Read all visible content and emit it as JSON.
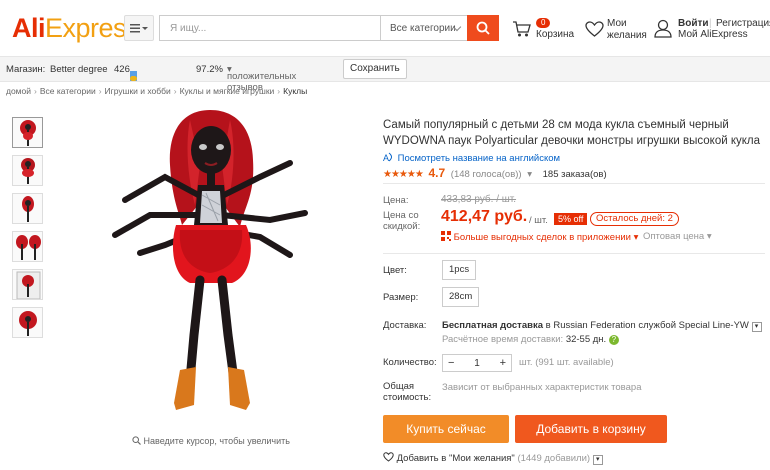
{
  "header": {
    "logo_ali": "Ali",
    "logo_express": "Express",
    "search_placeholder": "Я ищу...",
    "search_category": "Все категории",
    "cart_count": "0",
    "cart_label": "Корзина",
    "wish_line1": "Мои",
    "wish_line2": "желания",
    "login": "Войти",
    "separator": "|",
    "register": "Регистрация",
    "my_ali": "Мой AliExpress"
  },
  "store": {
    "label": "Магазин:",
    "name": "Better degree",
    "score": "426",
    "positive_pct": "97.2%",
    "positive_label": "положительных отзывов",
    "follow_label": "Сохранить"
  },
  "breadcrumb": [
    "домой",
    "Все категории",
    "Игрушки и хобби",
    "Куклы и мягкие игрушки",
    "Куклы"
  ],
  "gallery": {
    "zoom_hint": "Наведите курсор, чтобы увеличить",
    "thumb_count": 6
  },
  "product": {
    "title": "Самый популярный с детьми 28 см мода кукла съемный черный WYDOWNA паук Polyarticular девочки монстры игрушки высокой кукла",
    "translate_link": "Посмотреть название на английском",
    "stars": "★★★★★",
    "rating": "4.7",
    "votes": "(148 голоса(ов))",
    "orders": "185 заказа(ов)",
    "price_label": "Цена:",
    "old_price": "433,83 руб. / шт.",
    "discount_price_label_1": "Цена со",
    "discount_price_label_2": "скидкой:",
    "new_price": "412,47 руб.",
    "per_unit": "/ шт.",
    "off_badge": "5% off",
    "days_left": "Осталось дней: 2",
    "app_deals": "Больше выгодных сделок в приложении",
    "wholesale": "Оптовая цена",
    "color_label": "Цвет:",
    "color_value": "1pcs",
    "size_label": "Размер:",
    "size_value": "28cm",
    "shipping_label": "Доставка:",
    "shipping_free": "Бесплатная доставка",
    "shipping_to": "в",
    "shipping_country": "Russian Federation",
    "shipping_via": "службой",
    "shipping_service": "Special Line-YW",
    "delivery_time_label": "Расчётное время доставки:",
    "delivery_time": "32-55 дн.",
    "qty_label": "Количество:",
    "qty_value": "1",
    "qty_minus": "−",
    "qty_plus": "+",
    "qty_info": "шт. (991 шт. available)",
    "total_label_1": "Общая",
    "total_label_2": "стоимость:",
    "total_value": "Зависит от выбранных характеристик товара",
    "buy_now": "Купить сейчас",
    "add_cart": "Добавить в корзину",
    "add_wish": "Добавить в \"Мои желания\"",
    "wish_count": "(1449 добавили)"
  },
  "colors": {
    "brand_red": "#e62e04",
    "brand_orange": "#f2a012",
    "buy_button": "#f28c28",
    "cart_button": "#f0581e",
    "link_blue": "#0563c8"
  }
}
